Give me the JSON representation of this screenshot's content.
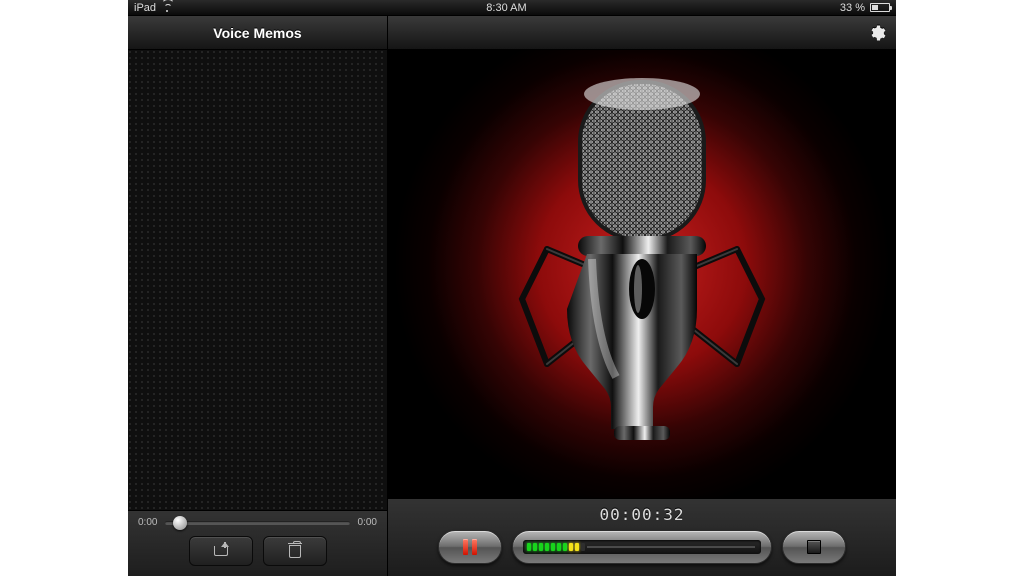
{
  "status": {
    "device": "iPad",
    "time": "8:30 AM",
    "battery_pct": "33 %"
  },
  "sidebar": {
    "title": "Voice Memos",
    "playback": {
      "elapsed": "0:00",
      "remaining": "0:00"
    }
  },
  "main": {
    "timer": "00:00:32"
  }
}
